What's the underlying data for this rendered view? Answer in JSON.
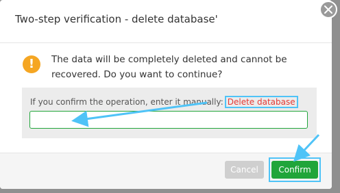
{
  "dialog": {
    "title": "Two-step verification - delete database'",
    "message": "The data will be completely deleted and cannot be recovered. Do you want to continue?",
    "hint_prefix": "If you confirm the operation, enter it manually:",
    "keyword": "Delete database",
    "input_value": "",
    "cancel_label": "Cancel",
    "confirm_label": "Confirm",
    "warning_glyph": "!",
    "icons": {
      "close": "close-icon",
      "warning": "warning-icon"
    }
  },
  "colors": {
    "confirm_green": "#20a53a",
    "warning_orange": "#f5a623",
    "keyword_red": "#e53935",
    "highlight_blue": "#4fc3f7",
    "backdrop_gray": "#8f8f8f"
  }
}
